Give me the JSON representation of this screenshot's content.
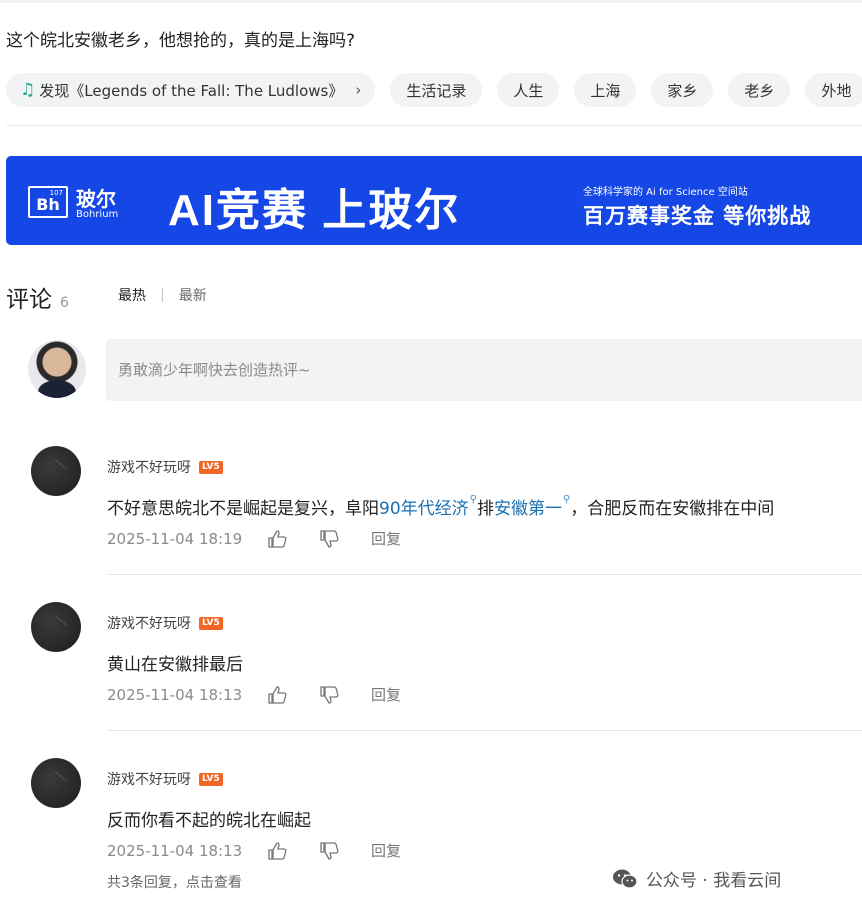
{
  "post": {
    "title": "这个皖北安徽老乡，他想抢的，真的是上海吗?"
  },
  "tags": [
    {
      "label": "发现《Legends of the Fall: The Ludlows》",
      "icon": "music-note-icon",
      "chevron": "›"
    },
    {
      "label": "生活记录"
    },
    {
      "label": "人生"
    },
    {
      "label": "上海"
    },
    {
      "label": "家乡"
    },
    {
      "label": "老乡"
    },
    {
      "label": "外地"
    }
  ],
  "banner": {
    "logo_cn": "玻尔",
    "logo_en": "Bohrium",
    "logo_mark": "Bh",
    "logo_sup": "107",
    "slogan": "AI竞赛  上玻尔",
    "small": "全球科学家的 Ai for Science 空间站",
    "big": "百万赛事奖金  等你挑战",
    "bg_color": "#1546e6"
  },
  "comments_section": {
    "heading": "评论",
    "count": "6",
    "sort_hot": "最热",
    "sort_sep": "|",
    "sort_new": "最新",
    "compose_placeholder": "勇敢滴少年啊快去创造热评~"
  },
  "comments": [
    {
      "user": "游戏不好玩呀",
      "level": "LV5",
      "text_before": "不好意思皖北不是崛起是复兴，阜阳",
      "kw1": "90年代经济",
      "text_mid": "排",
      "kw2": "安徽第一",
      "text_after": "，合肥反而在安徽排在中间",
      "time": "2025-11-04 18:19",
      "reply": "回复"
    },
    {
      "user": "游戏不好玩呀",
      "level": "LV5",
      "text": "黄山在安徽排最后",
      "time": "2025-11-04 18:13",
      "reply": "回复"
    },
    {
      "user": "游戏不好玩呀",
      "level": "LV5",
      "text": "反而你看不起的皖北在崛起",
      "time": "2025-11-04 18:13",
      "reply": "回复"
    }
  ],
  "more_replies": "共3条回复，点击查看",
  "watermark": "公众号 · 我看云间",
  "colors": {
    "keyword": "#1a6fb0",
    "level_badge": "#f26522",
    "music_icon": "#1ba784"
  }
}
